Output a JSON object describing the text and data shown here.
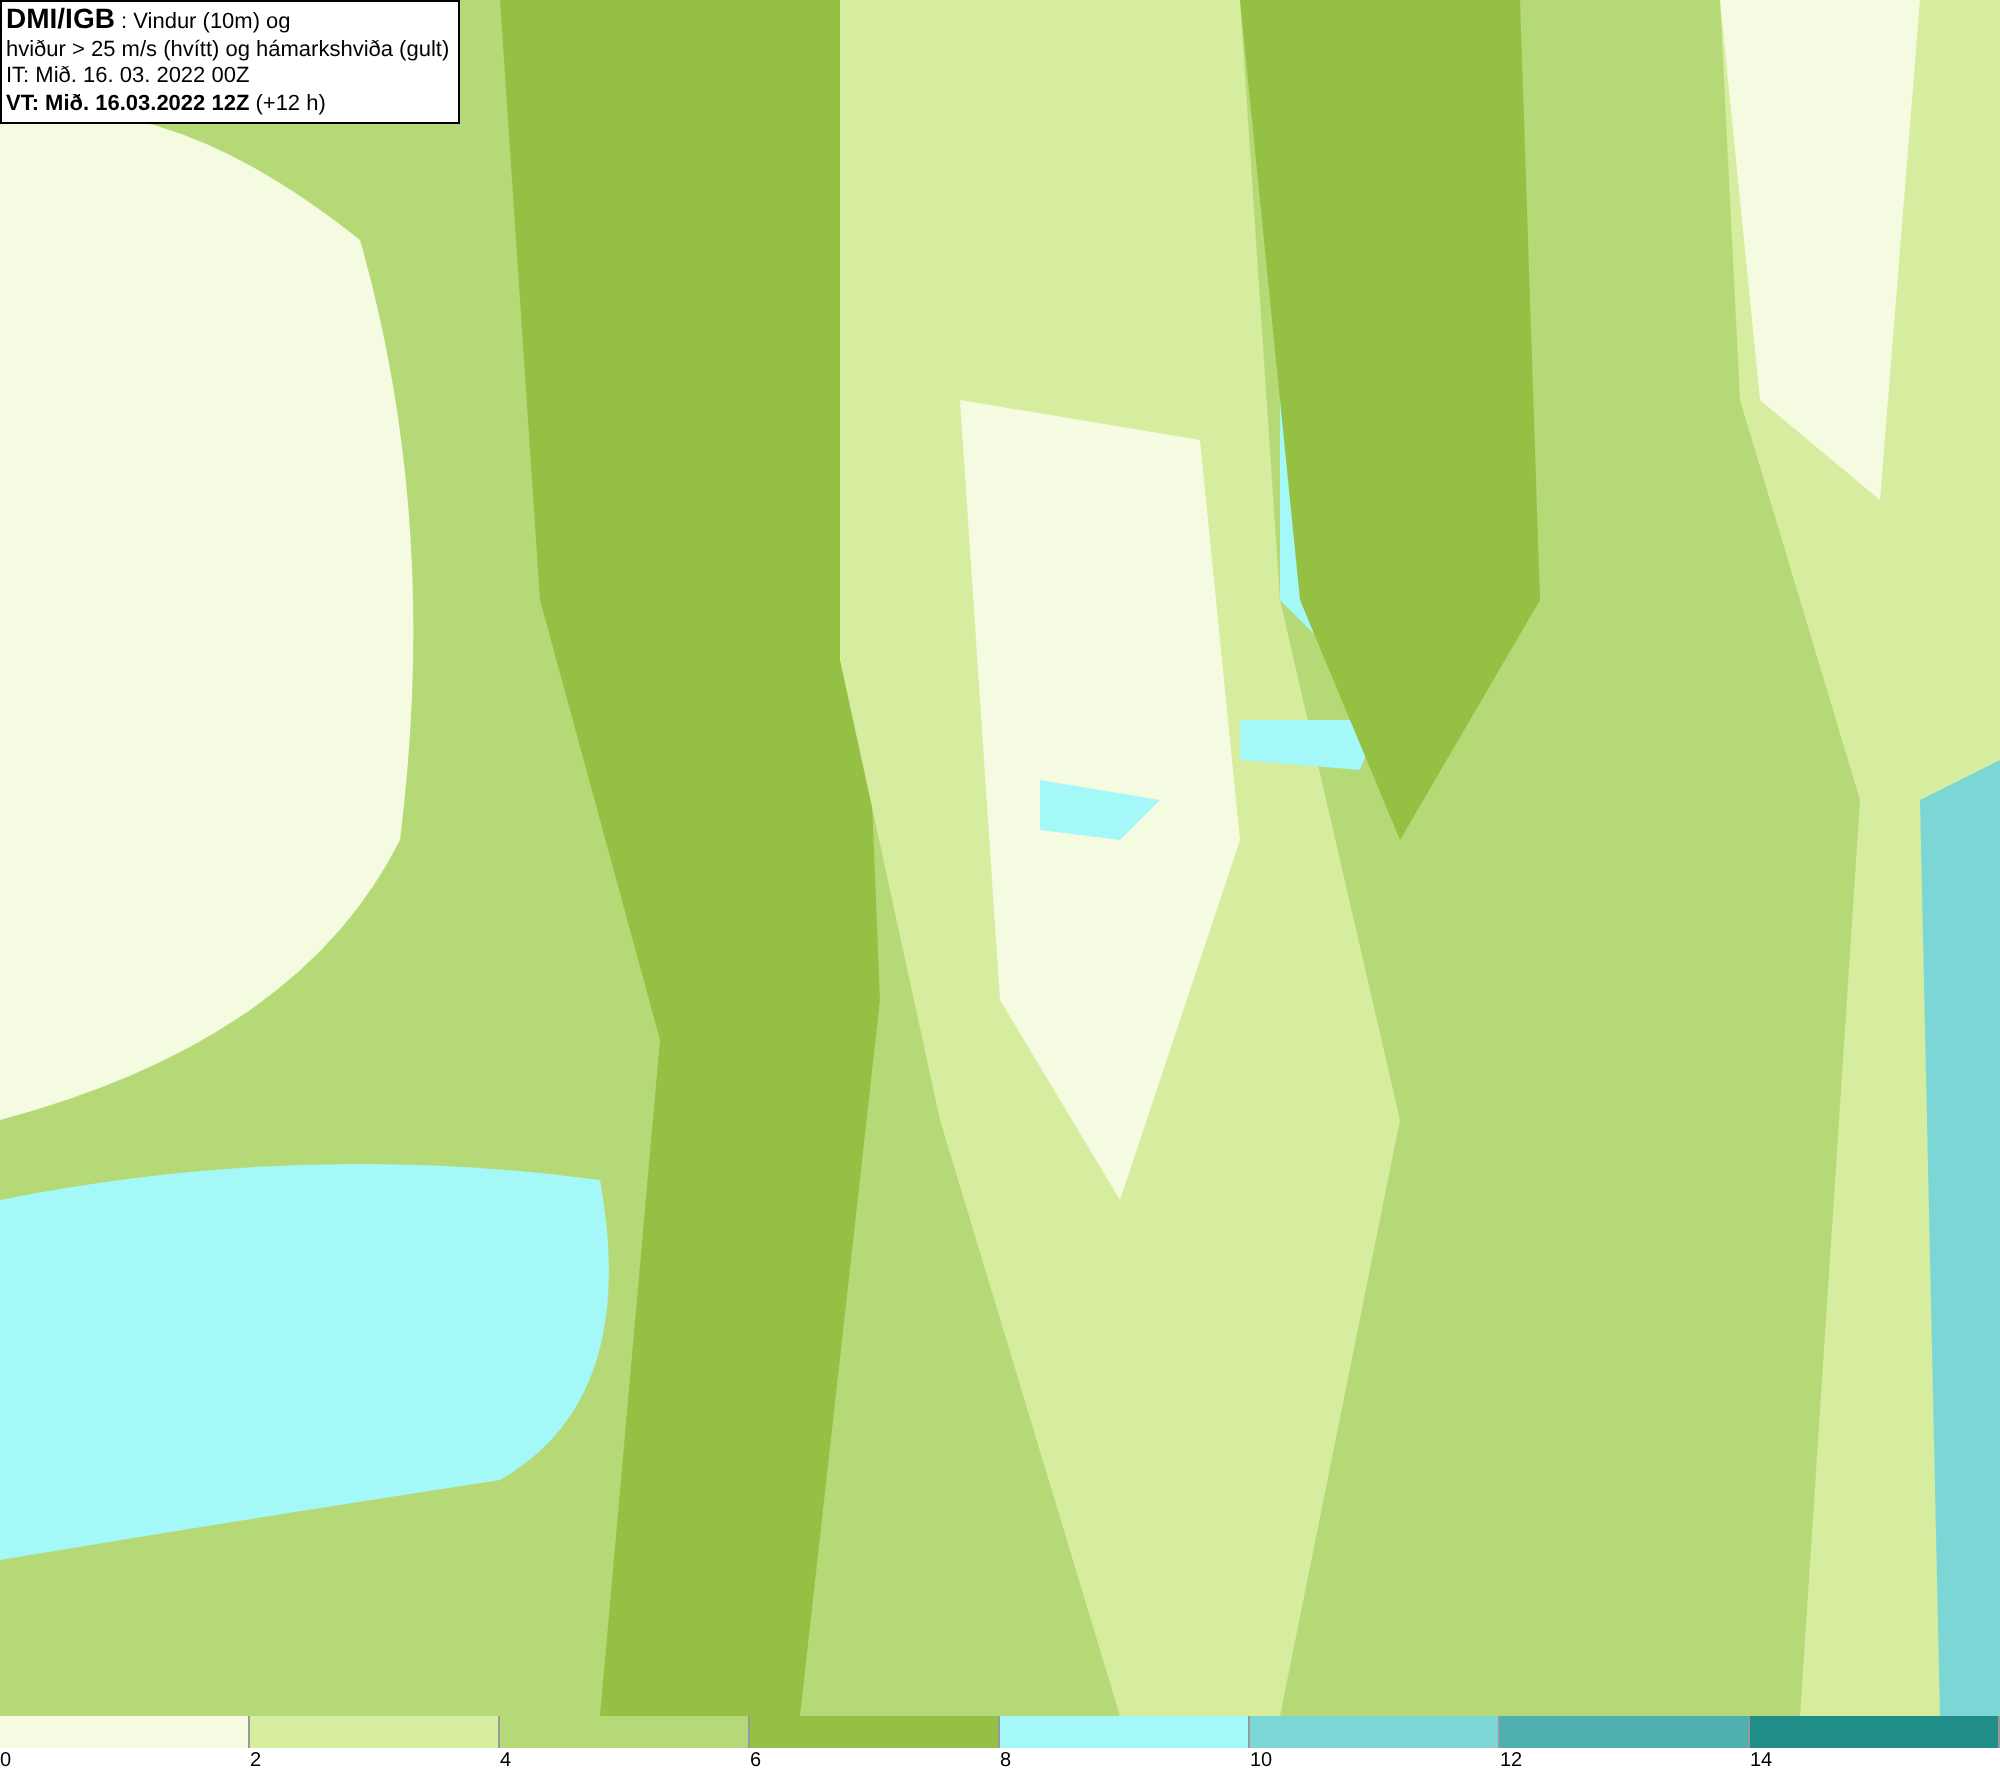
{
  "title_box": {
    "lines": [
      "**DMI/IGB** : Vindur (10m) og",
      "hviður > 25 m/s (hvítt) og hámarkshviða (gult)",
      "IT: Mið. 16. 03. 2022 00Z",
      "**VT: Mið. 16.03.2022 12Z** (+12 h)"
    ]
  },
  "legend": {
    "bins": [
      {
        "color": "#f5fbe0",
        "label": "0"
      },
      {
        "color": "#d6ec9e",
        "label": "2"
      },
      {
        "color": "#b5d977",
        "label": "4"
      },
      {
        "color": "#94c043",
        "label": "6"
      },
      {
        "color": "#a5f8f8",
        "label": "8"
      },
      {
        "color": "#7dd6d6",
        "label": "10"
      },
      {
        "color": "#4fb0b0",
        "label": "12"
      },
      {
        "color": "#208f8a",
        "label": "14"
      }
    ]
  }
}
